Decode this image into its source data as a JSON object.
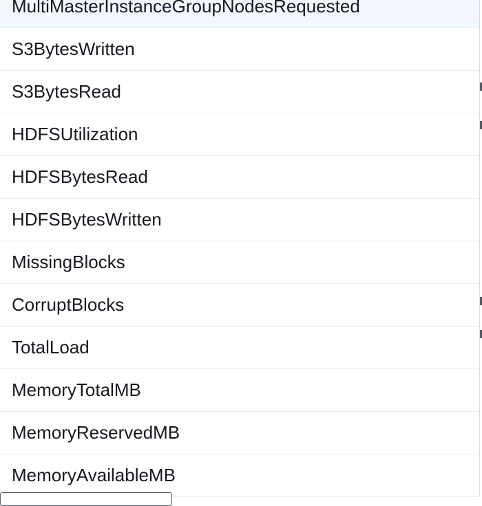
{
  "metrics_list": {
    "items": [
      "MultiMasterInstanceGroupNodesRequested",
      "S3BytesWritten",
      "S3BytesRead",
      "HDFSUtilization",
      "HDFSBytesRead",
      "HDFSBytesWritten",
      "MissingBlocks",
      "CorruptBlocks",
      "TotalLoad",
      "MemoryTotalMB",
      "MemoryReservedMB",
      "MemoryAvailableMB"
    ]
  }
}
